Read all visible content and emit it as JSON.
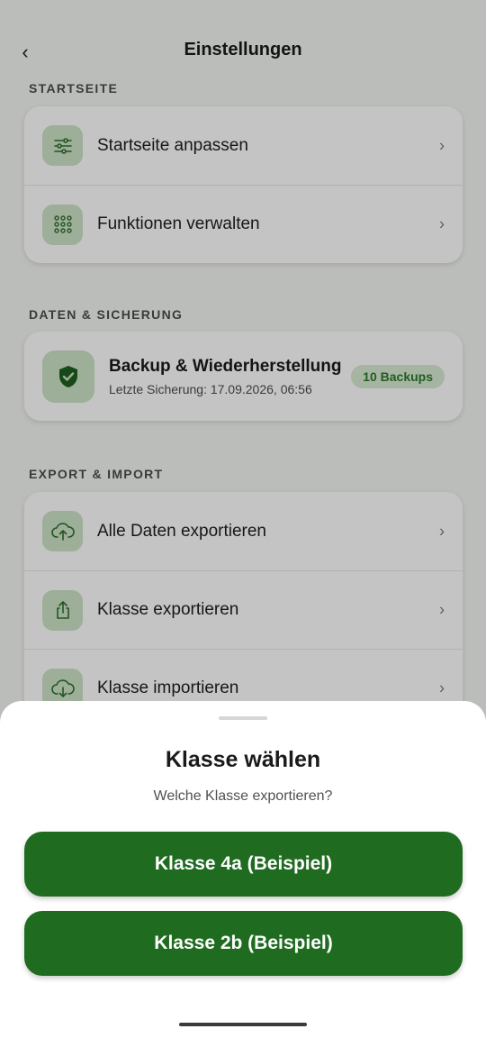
{
  "header": {
    "title": "Einstellungen",
    "back_icon": "‹"
  },
  "sections": {
    "startseite": {
      "label": "STARTSEITE",
      "items": [
        {
          "label": "Startseite anpassen",
          "icon": "sliders-icon"
        },
        {
          "label": "Funktionen verwalten",
          "icon": "grid-dots-icon"
        }
      ]
    },
    "daten": {
      "label": "DATEN & SICHERUNG",
      "backup": {
        "title": "Backup & Wiederherstellung",
        "subtitle": "Letzte Sicherung: 17.09.2026, 06:56",
        "badge": "10 Backups",
        "icon": "shield-check-icon"
      }
    },
    "export": {
      "label": "EXPORT & IMPORT",
      "items": [
        {
          "label": "Alle Daten exportieren",
          "icon": "cloud-upload-icon"
        },
        {
          "label": "Klasse exportieren",
          "icon": "share-icon"
        },
        {
          "label": "Klasse importieren",
          "icon": "cloud-download-icon"
        }
      ]
    }
  },
  "chevron": "›",
  "sheet": {
    "title": "Klasse wählen",
    "subtitle": "Welche Klasse exportieren?",
    "options": [
      {
        "label": "Klasse 4a (Beispiel)"
      },
      {
        "label": "Klasse 2b (Beispiel)"
      }
    ]
  },
  "colors": {
    "accent": "#1f6b20",
    "icon_bg": "#cde3c8",
    "icon_fg": "#2f6f2d",
    "badge_text": "#2d7a2a"
  }
}
